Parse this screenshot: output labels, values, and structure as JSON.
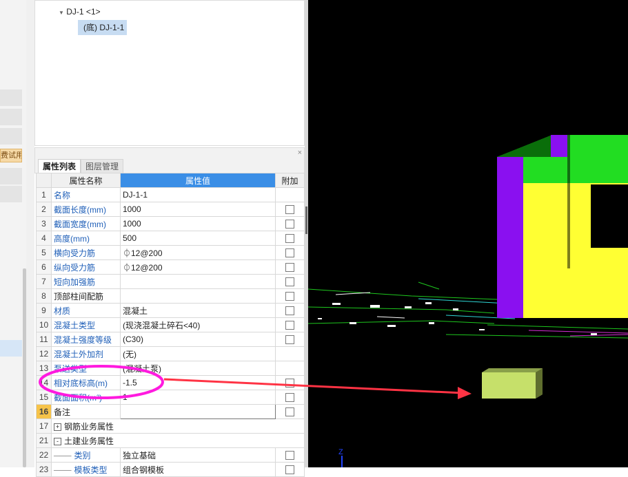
{
  "left_strip": {
    "trial_label": "费试用"
  },
  "tree": {
    "parent": "DJ-1 <1>",
    "child": "(底) DJ-1-1"
  },
  "panel": {
    "tabs": [
      "属性列表",
      "图层管理"
    ],
    "close_glyph": "×"
  },
  "table": {
    "headers": {
      "name": "属性名称",
      "value": "属性值",
      "extra": "附加"
    },
    "rows": [
      {
        "num": "1",
        "name": "名称",
        "value": "DJ-1-1",
        "checkbox": false
      },
      {
        "num": "2",
        "name": "截面长度(mm)",
        "value": "1000",
        "checkbox": true
      },
      {
        "num": "3",
        "name": "截面宽度(mm)",
        "value": "1000",
        "checkbox": true
      },
      {
        "num": "4",
        "name": "高度(mm)",
        "value": "500",
        "checkbox": true
      },
      {
        "num": "5",
        "name": "横向受力筋",
        "value": "⏀12@200",
        "checkbox": true
      },
      {
        "num": "6",
        "name": "纵向受力筋",
        "value": "⏀12@200",
        "checkbox": true
      },
      {
        "num": "7",
        "name": "短向加强筋",
        "value": "",
        "checkbox": true
      },
      {
        "num": "8",
        "name": "顶部柱间配筋",
        "value": "",
        "checkbox": true
      },
      {
        "num": "9",
        "name": "材质",
        "value": "混凝土",
        "checkbox": true
      },
      {
        "num": "10",
        "name": "混凝土类型",
        "value": "(现浇混凝土碎石<40)",
        "checkbox": true
      },
      {
        "num": "11",
        "name": "混凝土强度等级",
        "value": "(C30)",
        "checkbox": true
      },
      {
        "num": "12",
        "name": "混凝土外加剂",
        "value": "(无)",
        "checkbox": false
      },
      {
        "num": "13",
        "name": "泵送类型",
        "value": "(混凝土泵)",
        "checkbox": false
      },
      {
        "num": "14",
        "name": "相对底标高(m)",
        "value": "-1.5",
        "checkbox": true
      },
      {
        "num": "15",
        "name": "截面面积(m²)",
        "value": "1",
        "checkbox": true
      },
      {
        "num": "16",
        "name": "备注",
        "value": "",
        "checkbox": true
      },
      {
        "num": "17",
        "name": "钢筋业务属性",
        "value": "",
        "group": "+"
      },
      {
        "num": "21",
        "name": "土建业务属性",
        "value": "",
        "group": "-"
      },
      {
        "num": "22",
        "name": "类别",
        "value": "独立基础",
        "checkbox": true,
        "sub": true
      },
      {
        "num": "23",
        "name": "模板类型",
        "value": "组合钢模板",
        "checkbox": true,
        "sub": true
      }
    ]
  },
  "viewport": {
    "axis_label": "Z"
  },
  "colors": {
    "annotation": "#ff1adf",
    "arrow": "#ff3344",
    "accent": "#3a8ee6",
    "row16": "#f6c34a",
    "wall_purple": "#8a10f0",
    "wall_green": "#22dd22",
    "wall_yellow": "#ffff33",
    "footing": "#c6e06a"
  }
}
